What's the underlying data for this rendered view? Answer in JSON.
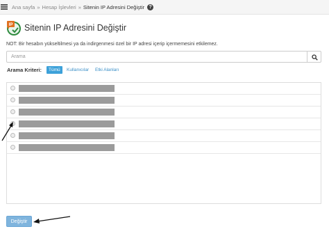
{
  "breadcrumb": {
    "items": [
      "Ana sayfa",
      "Hesap İşlevleri",
      "Sitenin IP Adresini Değiştir"
    ],
    "separator": "»",
    "help_glyph": "?"
  },
  "page": {
    "title": "Sitenin IP Adresini Değiştir",
    "logo_icon": "ip-change-icon",
    "note": "NOT: Bir hesabın yükseltilmesi ya da indirgenmesi özel bir IP adresi içerip içermemesini etkilemez."
  },
  "search": {
    "placeholder": "Arama",
    "value": "",
    "icon": "search-icon"
  },
  "filter": {
    "label": "Arama Kriteri:",
    "options": [
      {
        "label": "Tümü",
        "selected": true
      },
      {
        "label": "Kullanıcılar",
        "selected": false
      },
      {
        "label": "Etki Alanları",
        "selected": false
      }
    ]
  },
  "list": {
    "rows": [
      {
        "selected": false,
        "redacted": true
      },
      {
        "selected": false,
        "redacted": true
      },
      {
        "selected": false,
        "redacted": true
      },
      {
        "selected": false,
        "redacted": true
      },
      {
        "selected": false,
        "redacted": true
      },
      {
        "selected": false,
        "redacted": true
      }
    ]
  },
  "actions": {
    "submit_label": "Değiştir"
  },
  "colors": {
    "accent": "#3da1d9",
    "link": "#3a8fc7",
    "button": "#7fb4dd",
    "redaction": "#9b9b9b",
    "annotation_arrow": "#111111"
  }
}
